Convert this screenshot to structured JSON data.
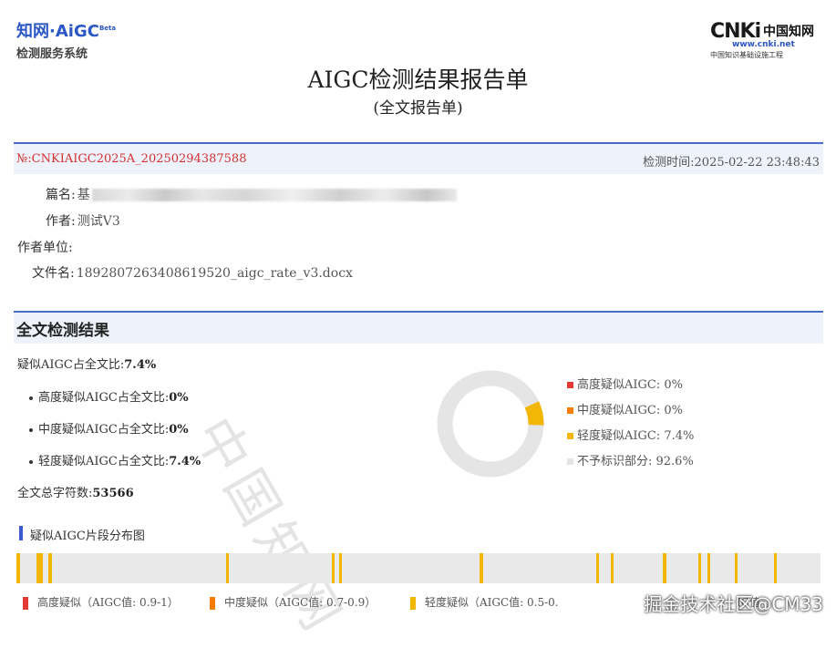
{
  "header": {
    "logo_line1": "知网·AiGC",
    "logo_beta": "Beta",
    "logo_line2": "检测服务系统",
    "cnki_mark": "CNKi",
    "cnki_cn": "中国知网",
    "cnki_url": "www.cnki.net",
    "cnki_sub": "中国知识基础设施工程"
  },
  "title": "AIGC检测结果报告单",
  "subtitle": "(全文报告单)",
  "report_no": "№:CNKIAIGC2025A_20250294387588",
  "test_time": "检测时间:2025-02-22 23:48:43",
  "info": {
    "title_label": "篇名:",
    "title_value_visible": "基",
    "author_label": "作者:",
    "author_value": "测试V3",
    "unit_label": "作者单位:",
    "unit_value": "",
    "file_label": "文件名:",
    "file_value": "1892807263408619520_aigc_rate_v3.docx"
  },
  "section_title": "全文检测结果",
  "stats": {
    "total_label": "疑似AIGC占全文比:",
    "total_value": "7.4%",
    "high_label": "高度疑似AIGC占全文比:",
    "high_value": "0%",
    "mid_label": "中度疑似AIGC占全文比:",
    "mid_value": "0%",
    "low_label": "轻度疑似AIGC占全文比:",
    "low_value": "7.4%",
    "chars_label": "全文总字符数:",
    "chars_value": "53566"
  },
  "donut": {
    "high": 0,
    "mid": 0,
    "low": 7.4,
    "none": 92.6,
    "colors": {
      "high": "#e53935",
      "mid": "#f57c00",
      "low": "#f2b705",
      "none": "#e5e5e5"
    }
  },
  "legend": [
    {
      "label": "高度疑似AIGC: 0%",
      "color": "#e53935"
    },
    {
      "label": "中度疑似AIGC: 0%",
      "color": "#f57c00"
    },
    {
      "label": "轻度疑似AIGC: 7.4%",
      "color": "#f2b705"
    },
    {
      "label": "不予标识部分: 92.6%",
      "color": "#e5e5e5"
    }
  ],
  "distribution": {
    "title": "疑似AIGC片段分布图",
    "segments": [
      {
        "start": 0.0,
        "end": 0.004
      },
      {
        "start": 0.025,
        "end": 0.033
      },
      {
        "start": 0.04,
        "end": 0.044
      },
      {
        "start": 0.261,
        "end": 0.264
      },
      {
        "start": 0.392,
        "end": 0.396
      },
      {
        "start": 0.401,
        "end": 0.404
      },
      {
        "start": 0.576,
        "end": 0.58
      },
      {
        "start": 0.721,
        "end": 0.724
      },
      {
        "start": 0.739,
        "end": 0.742
      },
      {
        "start": 0.804,
        "end": 0.808
      },
      {
        "start": 0.848,
        "end": 0.851
      },
      {
        "start": 0.859,
        "end": 0.862
      },
      {
        "start": 0.893,
        "end": 0.897
      },
      {
        "start": 0.942,
        "end": 0.946
      }
    ]
  },
  "bottom_legend": {
    "high": "高度疑似（AIGC值: 0.9-1）",
    "mid": "中度疑似（AIGC值: 0.7-0.9）",
    "low": "轻度疑似（AIGC值: 0.5-0.",
    "extra": "IC值"
  },
  "watermark": "中国知网",
  "watermark2": "掘金技术社区@CM33"
}
